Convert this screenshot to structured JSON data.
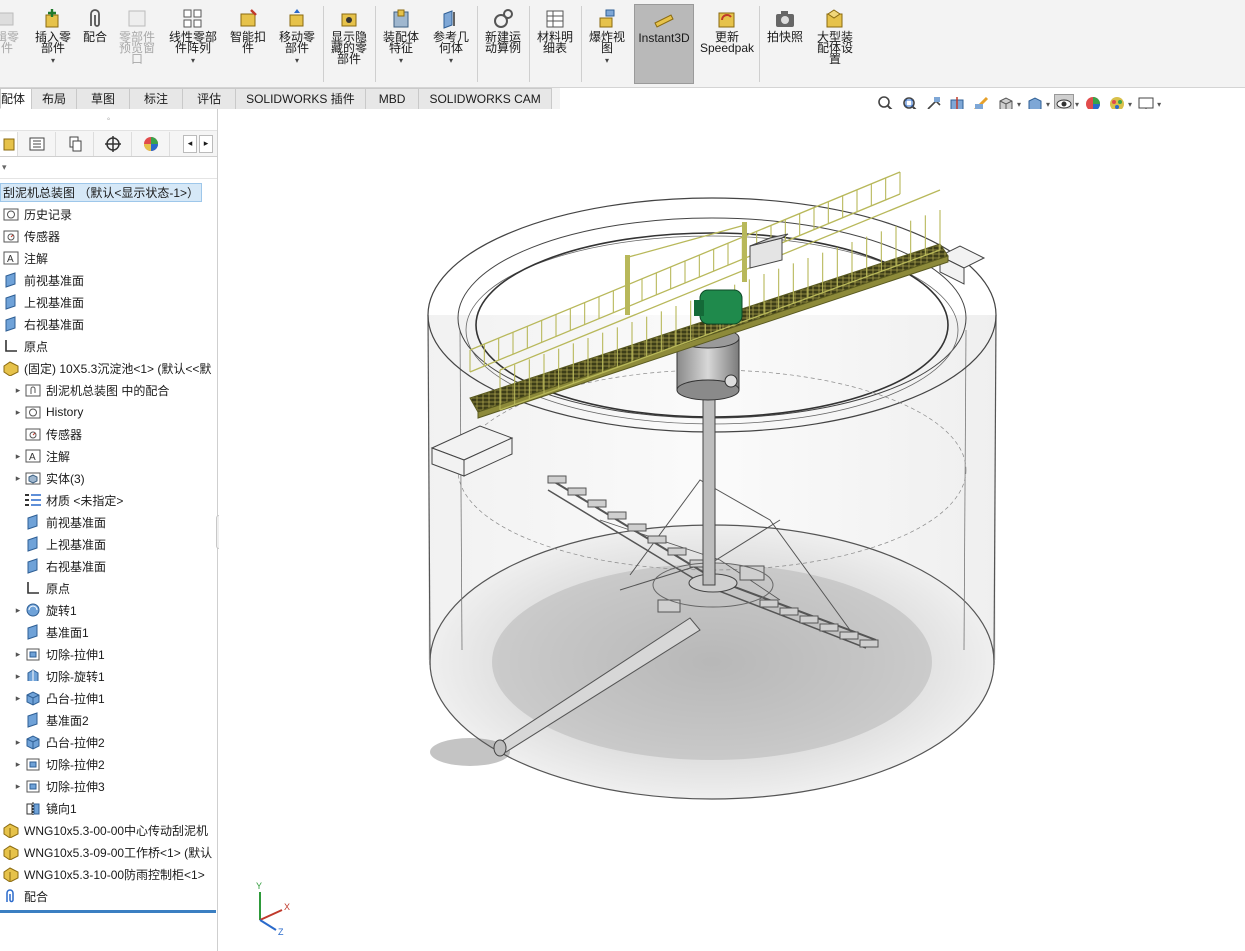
{
  "ribbon": {
    "buttons": [
      {
        "label": "插入零\n部件",
        "caret": true
      },
      {
        "label": "配合"
      },
      {
        "label": "零部件\n预览窗\n口",
        "disabled": true
      },
      {
        "label": "线性零部\n件阵列",
        "caret": true
      },
      {
        "label": "智能扣\n件"
      },
      {
        "label": "移动零\n部件",
        "caret": true
      },
      {
        "label": "显示隐\n藏的零\n部件"
      },
      {
        "label": "装配体\n特征",
        "caret": true
      },
      {
        "label": "参考几\n何体",
        "caret": true
      },
      {
        "label": "新建运\n动算例"
      },
      {
        "label": "材料明\n细表"
      },
      {
        "label": "爆炸视\n图",
        "caret": true
      },
      {
        "label": "Instant3D"
      },
      {
        "label": "更新\nSpeedpak"
      },
      {
        "label": "拍快照"
      },
      {
        "label": "大型装\n配体设\n置"
      }
    ],
    "partial_left_label": "辑零\n件"
  },
  "tabs": [
    "配体",
    "布局",
    "草图",
    "标注",
    "评估",
    "SOLIDWORKS 插件",
    "MBD",
    "SOLIDWORKS CAM"
  ],
  "hud_icons": [
    "zoom-to-fit-icon",
    "zoom-area-icon",
    "previous-view-icon",
    "section-view-icon",
    "dynamic-annotation-icon",
    "view-orientation-icon",
    "display-style-icon",
    "hide-show-items-icon",
    "edit-appearance-icon",
    "apply-scene-icon",
    "view-settings-icon"
  ],
  "tree": {
    "root": "刮泥机总装图 （默认<显示状态-1>）",
    "items": [
      {
        "label": "历史记录",
        "icon": "history-folder-icon",
        "indent": 0,
        "exp": false
      },
      {
        "label": "传感器",
        "icon": "sensors-icon",
        "indent": 0,
        "exp": false
      },
      {
        "label": "注解",
        "icon": "annotations-icon",
        "indent": 0,
        "exp": false
      },
      {
        "label": "前视基准面",
        "icon": "plane-icon",
        "indent": 0,
        "exp": false
      },
      {
        "label": "上视基准面",
        "icon": "plane-icon",
        "indent": 0,
        "exp": false
      },
      {
        "label": "右视基准面",
        "icon": "plane-icon",
        "indent": 0,
        "exp": false
      },
      {
        "label": "原点",
        "icon": "origin-icon",
        "indent": 0,
        "exp": false
      },
      {
        "label": "(固定) 10X5.3沉淀池<1> (默认<<默",
        "icon": "fixed-part-icon",
        "indent": 0,
        "exp": false
      },
      {
        "label": "刮泥机总装图 中的配合",
        "icon": "mates-folder-icon",
        "indent": 1,
        "exp": true
      },
      {
        "label": "History",
        "icon": "history-folder-icon",
        "indent": 1,
        "exp": true
      },
      {
        "label": "传感器",
        "icon": "sensors-icon",
        "indent": 1,
        "exp": false
      },
      {
        "label": "注解",
        "icon": "annotations-icon",
        "indent": 1,
        "exp": true
      },
      {
        "label": "实体(3)",
        "icon": "solid-bodies-icon",
        "indent": 1,
        "exp": true
      },
      {
        "label": "材质 <未指定>",
        "icon": "material-icon",
        "indent": 1,
        "exp": false
      },
      {
        "label": "前视基准面",
        "icon": "plane-icon",
        "indent": 1,
        "exp": false
      },
      {
        "label": "上视基准面",
        "icon": "plane-icon",
        "indent": 1,
        "exp": false
      },
      {
        "label": "右视基准面",
        "icon": "plane-icon",
        "indent": 1,
        "exp": false
      },
      {
        "label": "原点",
        "icon": "origin-icon",
        "indent": 1,
        "exp": false
      },
      {
        "label": "旋转1",
        "icon": "revolve-icon",
        "indent": 1,
        "exp": true
      },
      {
        "label": "基准面1",
        "icon": "plane-icon",
        "indent": 1,
        "exp": false
      },
      {
        "label": "切除-拉伸1",
        "icon": "cut-extrude-icon",
        "indent": 1,
        "exp": true
      },
      {
        "label": "切除-旋转1",
        "icon": "cut-revolve-icon",
        "indent": 1,
        "exp": true
      },
      {
        "label": "凸台-拉伸1",
        "icon": "boss-extrude-icon",
        "indent": 1,
        "exp": true
      },
      {
        "label": "基准面2",
        "icon": "plane-icon",
        "indent": 1,
        "exp": false
      },
      {
        "label": "凸台-拉伸2",
        "icon": "boss-extrude-icon",
        "indent": 1,
        "exp": true
      },
      {
        "label": "切除-拉伸2",
        "icon": "cut-extrude-icon",
        "indent": 1,
        "exp": true
      },
      {
        "label": "切除-拉伸3",
        "icon": "cut-extrude-icon",
        "indent": 1,
        "exp": true
      },
      {
        "label": "镜向1",
        "icon": "mirror-icon",
        "indent": 1,
        "exp": false
      },
      {
        "label": "WNG10x5.3-00-00中心传动刮泥机",
        "icon": "assembly-icon",
        "indent": 0,
        "exp": false
      },
      {
        "label": "WNG10x5.3-09-00工作桥<1> (默认",
        "icon": "assembly-icon",
        "indent": 0,
        "exp": false
      },
      {
        "label": "WNG10x5.3-10-00防雨控制柜<1>",
        "icon": "assembly-icon",
        "indent": 0,
        "exp": false
      },
      {
        "label": "配合",
        "icon": "mates-icon",
        "indent": 0,
        "exp": false
      }
    ]
  },
  "triad": {
    "x": "X",
    "y": "Y",
    "z": "Z"
  },
  "colors": {
    "ribbon_bg": "#f3f3f3",
    "tab_active": "#ffffff",
    "selection": "#d6e8f7",
    "accent_blue": "#3b7fc2",
    "bridge_green": "#b8b85a",
    "motor_green": "#1f8a4c"
  }
}
